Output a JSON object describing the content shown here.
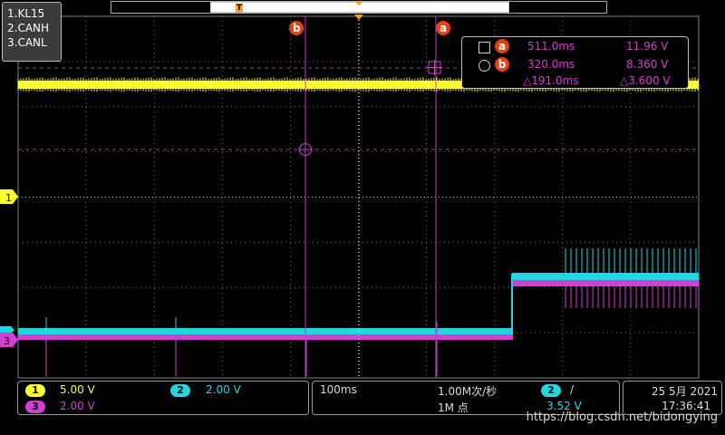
{
  "channels": [
    {
      "label": "1.KL15",
      "color": "#ffff30"
    },
    {
      "label": "2.CANH",
      "color": "#22d6e0"
    },
    {
      "label": "3.CANL",
      "color": "#d23fd2"
    }
  ],
  "markers": {
    "trigger_tag": "T",
    "ch1_marker": "1",
    "ch3_marker": "3",
    "cursor_a": "a",
    "cursor_b": "b"
  },
  "cursor_readout": {
    "a_time": "511.0ms",
    "a_value": "11.96 V",
    "b_time": "320.0ms",
    "b_value": "8.360 V",
    "delta_time": "△191.0ms",
    "delta_value": "△3.600 V"
  },
  "vertical": {
    "ch1_num": "1",
    "ch1_scale": "5.00 V",
    "ch2_num": "2",
    "ch2_scale": "2.00 V",
    "ch3_num": "3",
    "ch3_scale": "2.00 V"
  },
  "horizontal": {
    "timebase": "100ms",
    "sample_rate": "1.00M次/秒",
    "record_length": "1M 点"
  },
  "trigger": {
    "source": "2",
    "slope": "/",
    "level": "3.52 V"
  },
  "datetime": {
    "date": "25 5月 2021",
    "time": "17:36:41"
  },
  "watermark": "https://blog.csdn.net/bidongying",
  "colors": {
    "ch1": "#ffff30",
    "ch2": "#22d6e0",
    "ch3": "#d23fd2",
    "cursor_badge": "#e84010"
  }
}
